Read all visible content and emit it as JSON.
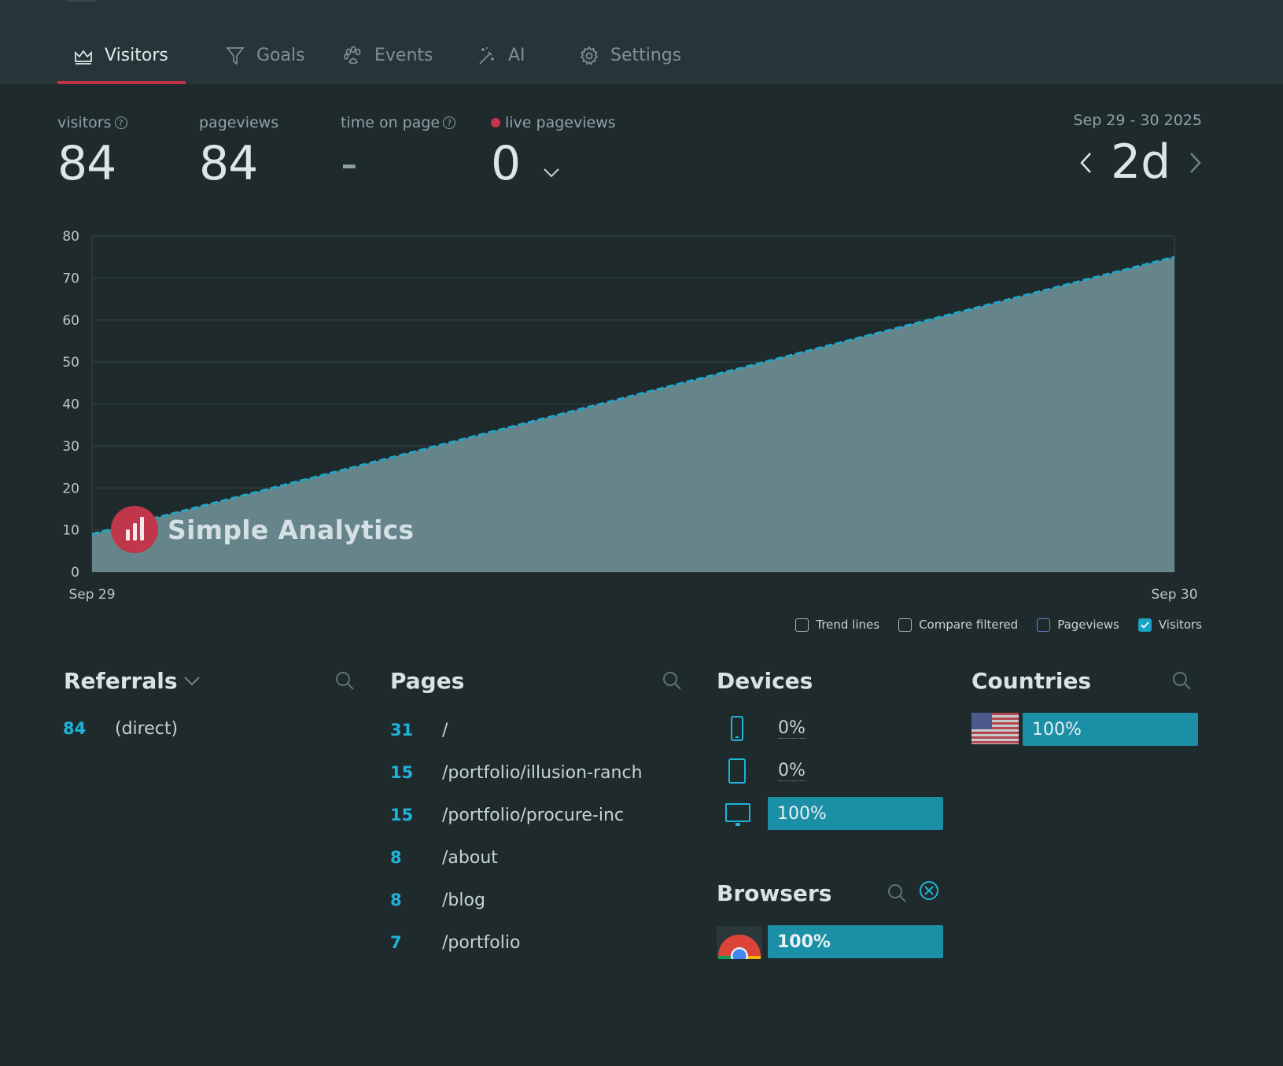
{
  "tabs": [
    {
      "label": "Visitors",
      "icon": "crown-icon",
      "active": true
    },
    {
      "label": "Goals",
      "icon": "funnel-icon",
      "active": false
    },
    {
      "label": "Events",
      "icon": "paw-icon",
      "active": false
    },
    {
      "label": "AI",
      "icon": "magic-wand-icon",
      "active": false
    },
    {
      "label": "Settings",
      "icon": "gear-icon",
      "active": false
    }
  ],
  "stats": {
    "visitors": {
      "label": "visitors",
      "value": "84"
    },
    "pageviews": {
      "label": "pageviews",
      "value": "84"
    },
    "time_on_page": {
      "label": "time on page",
      "value": "-"
    },
    "live_pageviews": {
      "label": "live pageviews",
      "value": "0"
    }
  },
  "date_range": {
    "label": "Sep 29 - 30 2025",
    "period": "2d"
  },
  "chart_data": {
    "type": "area",
    "x": [
      "Sep 29",
      "Sep 30"
    ],
    "series": [
      {
        "name": "Visitors",
        "values": [
          9,
          75
        ]
      }
    ],
    "ylim": [
      0,
      80
    ],
    "yticks": [
      0,
      10,
      20,
      30,
      40,
      50,
      60,
      70,
      80
    ],
    "grid": true,
    "line_color": "#1fa7c9",
    "fill_color": "#6a8a8f"
  },
  "watermark": {
    "text": "Simple Analytics"
  },
  "toggles": [
    {
      "label": "Trend lines",
      "checked": false
    },
    {
      "label": "Compare filtered",
      "checked": false
    },
    {
      "label": "Pageviews",
      "checked": false
    },
    {
      "label": "Visitors",
      "checked": true
    }
  ],
  "referrals": {
    "title": "Referrals",
    "rows": [
      {
        "count": "84",
        "label": "(direct)"
      }
    ]
  },
  "pages": {
    "title": "Pages",
    "rows": [
      {
        "count": "31",
        "label": "/"
      },
      {
        "count": "15",
        "label": "/portfolio/illusion-ranch"
      },
      {
        "count": "15",
        "label": "/portfolio/procure-inc"
      },
      {
        "count": "8",
        "label": "/about"
      },
      {
        "count": "8",
        "label": "/blog"
      },
      {
        "count": "7",
        "label": "/portfolio"
      }
    ]
  },
  "devices": {
    "title": "Devices",
    "rows": [
      {
        "icon": "phone-icon",
        "pct": "0%",
        "fraction": 0
      },
      {
        "icon": "tablet-icon",
        "pct": "0%",
        "fraction": 0
      },
      {
        "icon": "desktop-icon",
        "pct": "100%",
        "fraction": 1
      }
    ]
  },
  "browsers": {
    "title": "Browsers",
    "rows": [
      {
        "icon": "chrome-icon",
        "pct": "100%",
        "fraction": 1
      }
    ]
  },
  "countries": {
    "title": "Countries",
    "rows": [
      {
        "icon": "us-flag-icon",
        "pct": "100%",
        "fraction": 1
      }
    ]
  },
  "colors": {
    "accent": "#c0354a",
    "bar": "#1b8fa6",
    "number": "#1fb3d8"
  }
}
